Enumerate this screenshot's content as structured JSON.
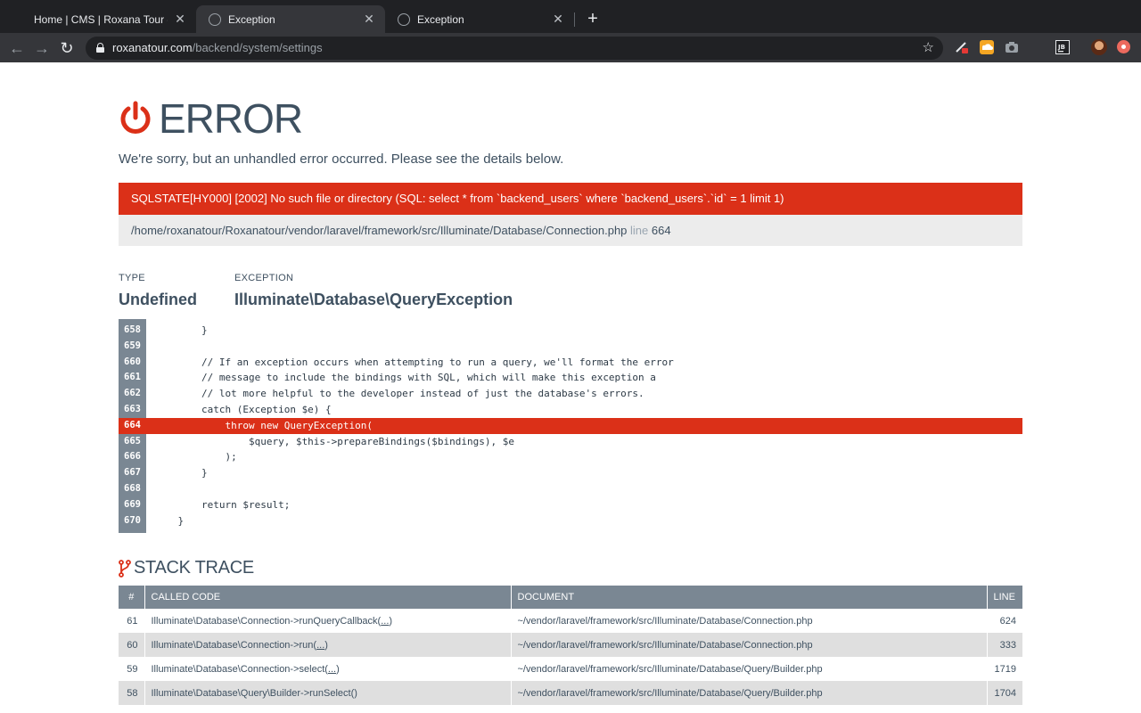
{
  "browser": {
    "tabs": [
      {
        "title": "Home | CMS | Roxana Tour - CI",
        "active": false
      },
      {
        "title": "Exception",
        "active": true
      },
      {
        "title": "Exception",
        "active": false
      }
    ],
    "new_tab": "+",
    "url_host": "roxanatour.com",
    "url_path": "/backend/system/settings",
    "icons": [
      "back-arrow-icon",
      "forward-arrow-icon",
      "reload-icon",
      "lock-icon",
      "star-icon",
      "close-icon"
    ]
  },
  "error": {
    "title": "ERROR",
    "subtitle": "We're sorry, but an unhandled error occurred. Please see the details below.",
    "message": "SQLSTATE[HY000] [2002] No such file or directory (SQL: select * from `backend_users` where `backend_users`.`id` = 1 limit 1)",
    "file": "/home/roxanatour/Roxanatour/vendor/laravel/framework/src/Illuminate/Database/Connection.php",
    "line_label": "line",
    "line_number": "664",
    "accent": "#db3018",
    "text_color": "#3e5060"
  },
  "meta": {
    "type_label": "TYPE",
    "type_value": "Undefined",
    "exception_label": "EXCEPTION",
    "exception_value": "Illuminate\\Database\\QueryException"
  },
  "code": {
    "highlight_line": 664,
    "lines": [
      {
        "num": "658",
        "src": "        }"
      },
      {
        "num": "659",
        "src": ""
      },
      {
        "num": "660",
        "src": "        // If an exception occurs when attempting to run a query, we'll format the error"
      },
      {
        "num": "661",
        "src": "        // message to include the bindings with SQL, which will make this exception a"
      },
      {
        "num": "662",
        "src": "        // lot more helpful to the developer instead of just the database's errors."
      },
      {
        "num": "663",
        "src": "        catch (Exception $e) {"
      },
      {
        "num": "664",
        "src": "            throw new QueryException("
      },
      {
        "num": "665",
        "src": "                $query, $this->prepareBindings($bindings), $e"
      },
      {
        "num": "666",
        "src": "            );"
      },
      {
        "num": "667",
        "src": "        }"
      },
      {
        "num": "668",
        "src": ""
      },
      {
        "num": "669",
        "src": "        return $result;"
      },
      {
        "num": "670",
        "src": "    }"
      }
    ]
  },
  "trace": {
    "title": "STACK TRACE",
    "columns": [
      "#",
      "CALLED CODE",
      "DOCUMENT",
      "LINE"
    ],
    "rows": [
      {
        "num": "61",
        "code": "Illuminate\\Database\\Connection->runQueryCallback(",
        "args": "...",
        "close": ")",
        "doc": "~/vendor/laravel/framework/src/Illuminate/Database/Connection.php",
        "line": "624"
      },
      {
        "num": "60",
        "code": "Illuminate\\Database\\Connection->run(",
        "args": "...",
        "close": ")",
        "doc": "~/vendor/laravel/framework/src/Illuminate/Database/Connection.php",
        "line": "333"
      },
      {
        "num": "59",
        "code": "Illuminate\\Database\\Connection->select(",
        "args": "...",
        "close": ")",
        "doc": "~/vendor/laravel/framework/src/Illuminate/Database/Query/Builder.php",
        "line": "1719"
      },
      {
        "num": "58",
        "code": "Illuminate\\Database\\Query\\Builder->runSelect()",
        "args": "",
        "close": "",
        "doc": "~/vendor/laravel/framework/src/Illuminate/Database/Query/Builder.php",
        "line": "1704"
      }
    ]
  }
}
